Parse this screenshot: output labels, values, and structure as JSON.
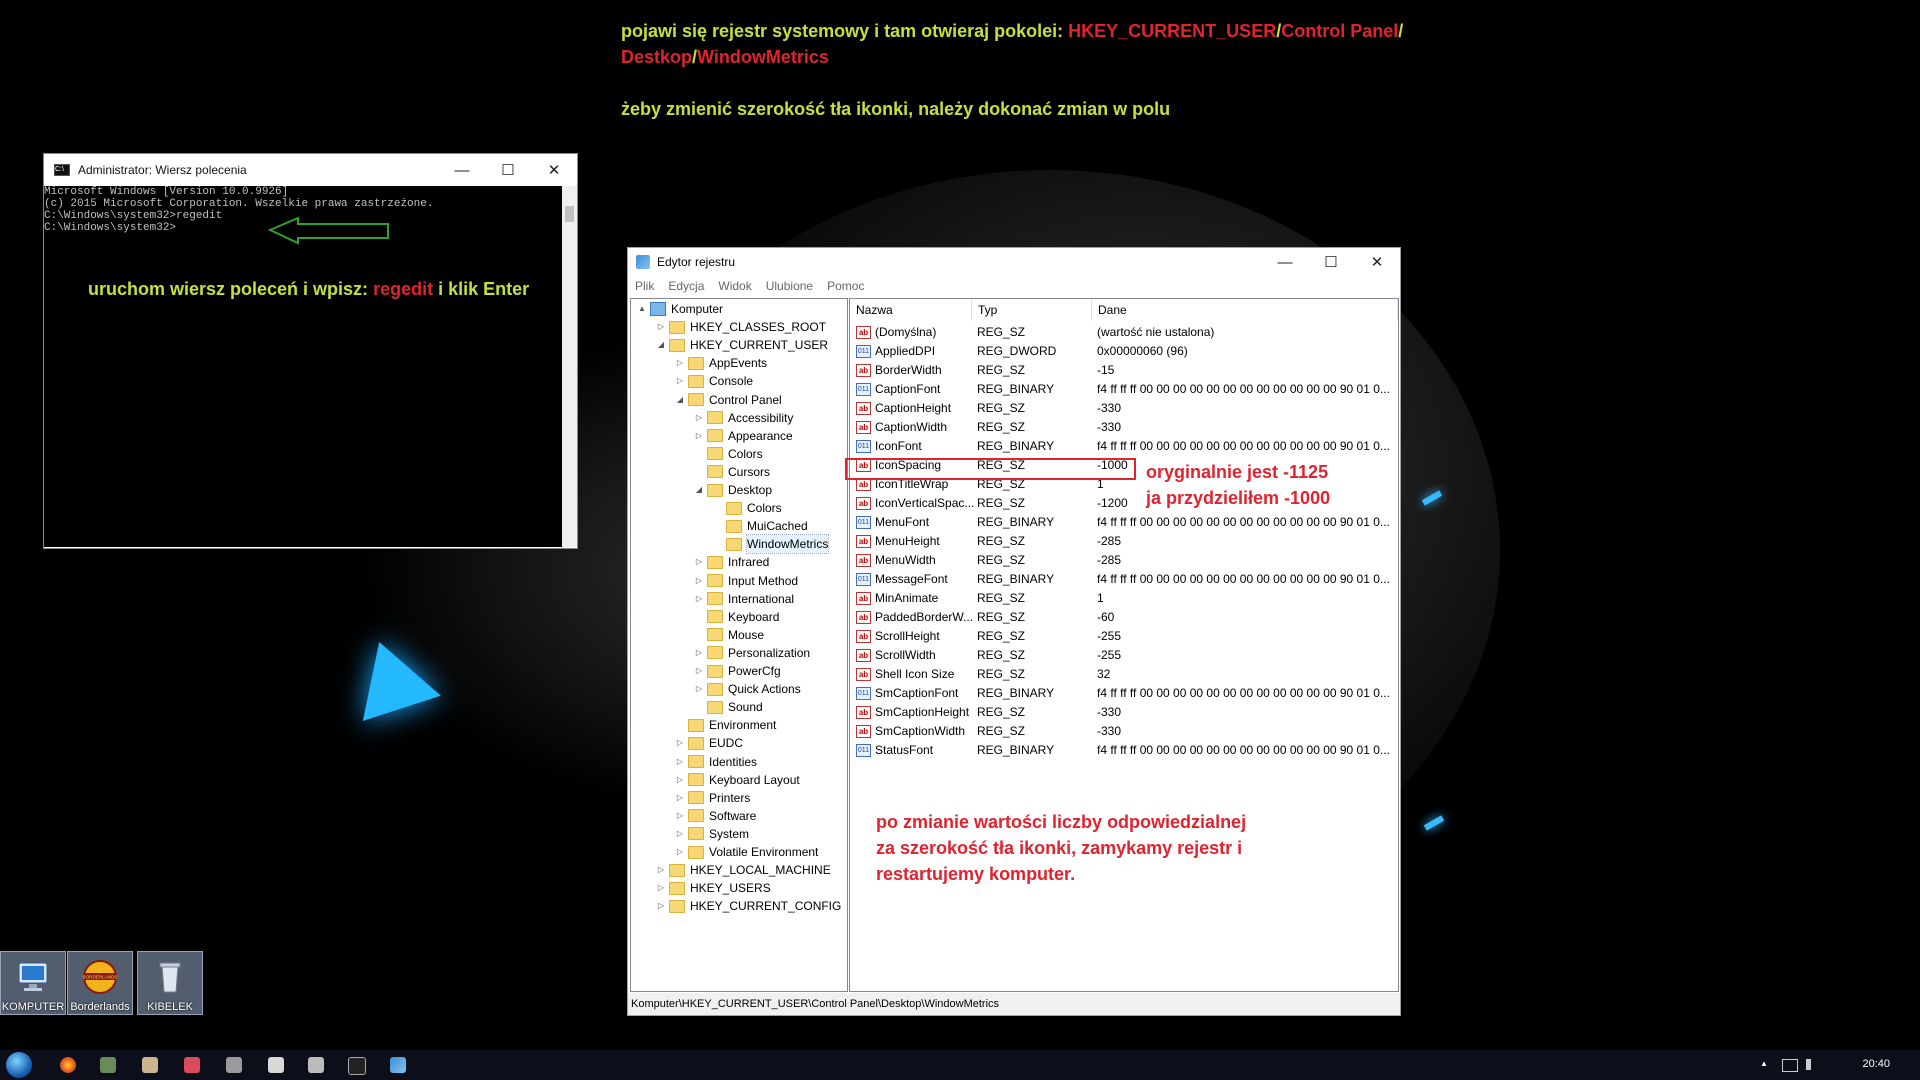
{
  "annotations": {
    "top_line1_a": "pojawi się rejestr systemowy i tam otwieraj pokolei: ",
    "top_line1_hkcu": "HKEY_CURRENT_USER",
    "top_slash1": "/",
    "top_line1_cp": "Control Panel",
    "top_slash2": "/",
    "top_line2_desktop": "Destkop",
    "top_slash3": "/",
    "top_line2_wm": "WindowMetrics",
    "top_line3": "żeby zmienić szerokość tła ikonki, należy dokonać zmian w polu",
    "cmd_note_a": "uruchom wiersz poleceń i wpisz: ",
    "cmd_note_regedit": "regedit",
    "cmd_note_b": "  i klik Enter",
    "orig_line1": "oryginalnie jest -1125",
    "orig_line2": "ja przydzieliłem -1000",
    "bottom_line1": "po zmianie wartości liczby odpowiedzialnej",
    "bottom_line2": "za szerokość tła ikonki, zamykamy rejestr i",
    "bottom_line3": "restartujemy komputer."
  },
  "cmd": {
    "title": "Administrator: Wiersz polecenia",
    "app_icon": "C:\\",
    "lines": [
      "Microsoft Windows [Version 10.0.9926]",
      "(c) 2015 Microsoft Corporation. Wszelkie prawa zastrzeżone.",
      "",
      "C:\\Windows\\system32>regedit",
      "",
      "C:\\Windows\\system32>"
    ]
  },
  "window_controls": {
    "minimize": "—",
    "maximize": "☐",
    "close": "✕"
  },
  "regedit": {
    "title": "Edytor rejestru",
    "menu": [
      "Plik",
      "Edycja",
      "Widok",
      "Ulubione",
      "Pomoc"
    ],
    "columns": [
      "Nazwa",
      "Typ",
      "Dane"
    ],
    "tree": [
      {
        "label": "Komputer",
        "level": 0,
        "exp": "▲",
        "kind": "pc"
      },
      {
        "label": "HKEY_CLASSES_ROOT",
        "level": 1,
        "exp": "▷"
      },
      {
        "label": "HKEY_CURRENT_USER",
        "level": 1,
        "exp": "◢"
      },
      {
        "label": "AppEvents",
        "level": 2,
        "exp": "▷"
      },
      {
        "label": "Console",
        "level": 2,
        "exp": "▷"
      },
      {
        "label": "Control Panel",
        "level": 2,
        "exp": "◢"
      },
      {
        "label": "Accessibility",
        "level": 3,
        "exp": "▷"
      },
      {
        "label": "Appearance",
        "level": 3,
        "exp": "▷"
      },
      {
        "label": "Colors",
        "level": 3,
        "exp": ""
      },
      {
        "label": "Cursors",
        "level": 3,
        "exp": ""
      },
      {
        "label": "Desktop",
        "level": 3,
        "exp": "◢"
      },
      {
        "label": "Colors",
        "level": 4,
        "exp": ""
      },
      {
        "label": "MuiCached",
        "level": 4,
        "exp": ""
      },
      {
        "label": "WindowMetrics",
        "level": 4,
        "exp": "",
        "selected": true
      },
      {
        "label": "Infrared",
        "level": 3,
        "exp": "▷"
      },
      {
        "label": "Input Method",
        "level": 3,
        "exp": "▷"
      },
      {
        "label": "International",
        "level": 3,
        "exp": "▷"
      },
      {
        "label": "Keyboard",
        "level": 3,
        "exp": ""
      },
      {
        "label": "Mouse",
        "level": 3,
        "exp": ""
      },
      {
        "label": "Personalization",
        "level": 3,
        "exp": "▷"
      },
      {
        "label": "PowerCfg",
        "level": 3,
        "exp": "▷"
      },
      {
        "label": "Quick Actions",
        "level": 3,
        "exp": "▷"
      },
      {
        "label": "Sound",
        "level": 3,
        "exp": ""
      },
      {
        "label": "Environment",
        "level": 2,
        "exp": ""
      },
      {
        "label": "EUDC",
        "level": 2,
        "exp": "▷"
      },
      {
        "label": "Identities",
        "level": 2,
        "exp": "▷"
      },
      {
        "label": "Keyboard Layout",
        "level": 2,
        "exp": "▷"
      },
      {
        "label": "Printers",
        "level": 2,
        "exp": "▷"
      },
      {
        "label": "Software",
        "level": 2,
        "exp": "▷"
      },
      {
        "label": "System",
        "level": 2,
        "exp": "▷"
      },
      {
        "label": "Volatile Environment",
        "level": 2,
        "exp": "▷"
      },
      {
        "label": "HKEY_LOCAL_MACHINE",
        "level": 1,
        "exp": "▷"
      },
      {
        "label": "HKEY_USERS",
        "level": 1,
        "exp": "▷"
      },
      {
        "label": "HKEY_CURRENT_CONFIG",
        "level": 1,
        "exp": "▷"
      }
    ],
    "values": [
      {
        "name": "(Domyślna)",
        "type": "REG_SZ",
        "data": "(wartość nie ustalona)",
        "icon": "sz"
      },
      {
        "name": "AppliedDPI",
        "type": "REG_DWORD",
        "data": "0x00000060 (96)",
        "icon": "bin"
      },
      {
        "name": "BorderWidth",
        "type": "REG_SZ",
        "data": "-15",
        "icon": "sz"
      },
      {
        "name": "CaptionFont",
        "type": "REG_BINARY",
        "data": "f4 ff ff ff 00 00 00 00 00 00 00 00 00 00 00 00 90 01 0...",
        "icon": "bin"
      },
      {
        "name": "CaptionHeight",
        "type": "REG_SZ",
        "data": "-330",
        "icon": "sz"
      },
      {
        "name": "CaptionWidth",
        "type": "REG_SZ",
        "data": "-330",
        "icon": "sz"
      },
      {
        "name": "IconFont",
        "type": "REG_BINARY",
        "data": "f4 ff ff ff 00 00 00 00 00 00 00 00 00 00 00 00 90 01 0...",
        "icon": "bin"
      },
      {
        "name": "IconSpacing",
        "type": "REG_SZ",
        "data": "-1000",
        "icon": "sz",
        "selected": true
      },
      {
        "name": "IconTitleWrap",
        "type": "REG_SZ",
        "data": "1",
        "icon": "sz"
      },
      {
        "name": "IconVerticalSpac...",
        "type": "REG_SZ",
        "data": "-1200",
        "icon": "sz"
      },
      {
        "name": "MenuFont",
        "type": "REG_BINARY",
        "data": "f4 ff ff ff 00 00 00 00 00 00 00 00 00 00 00 00 90 01 0...",
        "icon": "bin"
      },
      {
        "name": "MenuHeight",
        "type": "REG_SZ",
        "data": "-285",
        "icon": "sz"
      },
      {
        "name": "MenuWidth",
        "type": "REG_SZ",
        "data": "-285",
        "icon": "sz"
      },
      {
        "name": "MessageFont",
        "type": "REG_BINARY",
        "data": "f4 ff ff ff 00 00 00 00 00 00 00 00 00 00 00 00 90 01 0...",
        "icon": "bin"
      },
      {
        "name": "MinAnimate",
        "type": "REG_SZ",
        "data": "1",
        "icon": "sz"
      },
      {
        "name": "PaddedBorderW...",
        "type": "REG_SZ",
        "data": "-60",
        "icon": "sz"
      },
      {
        "name": "ScrollHeight",
        "type": "REG_SZ",
        "data": "-255",
        "icon": "sz"
      },
      {
        "name": "ScrollWidth",
        "type": "REG_SZ",
        "data": "-255",
        "icon": "sz"
      },
      {
        "name": "Shell Icon Size",
        "type": "REG_SZ",
        "data": "32",
        "icon": "sz"
      },
      {
        "name": "SmCaptionFont",
        "type": "REG_BINARY",
        "data": "f4 ff ff ff 00 00 00 00 00 00 00 00 00 00 00 00 90 01 0...",
        "icon": "bin"
      },
      {
        "name": "SmCaptionHeight",
        "type": "REG_SZ",
        "data": "-330",
        "icon": "sz"
      },
      {
        "name": "SmCaptionWidth",
        "type": "REG_SZ",
        "data": "-330",
        "icon": "sz"
      },
      {
        "name": "StatusFont",
        "type": "REG_BINARY",
        "data": "f4 ff ff ff 00 00 00 00 00 00 00 00 00 00 00 00 90 01 0...",
        "icon": "bin"
      }
    ],
    "icon_sz_text": "ab",
    "icon_bin_text": "011",
    "status_path": "Komputer\\HKEY_CURRENT_USER\\Control Panel\\Desktop\\WindowMetrics"
  },
  "desktop_icons": [
    {
      "label": "KOMPUTER",
      "icon": "computer-icon"
    },
    {
      "label": "Borderlands",
      "icon": "borderlands-icon",
      "logo_text": "BORDERLANDS"
    },
    {
      "label": "KIBELEK",
      "icon": "recycle-bin-icon"
    }
  ],
  "taskbar": {
    "clock": "20:40",
    "tray_chevron": "▲",
    "colors": {
      "accent_green": "#c6e03a",
      "accent_red": "#e0232e",
      "wallpaper_blue": "#24b8ff"
    }
  }
}
